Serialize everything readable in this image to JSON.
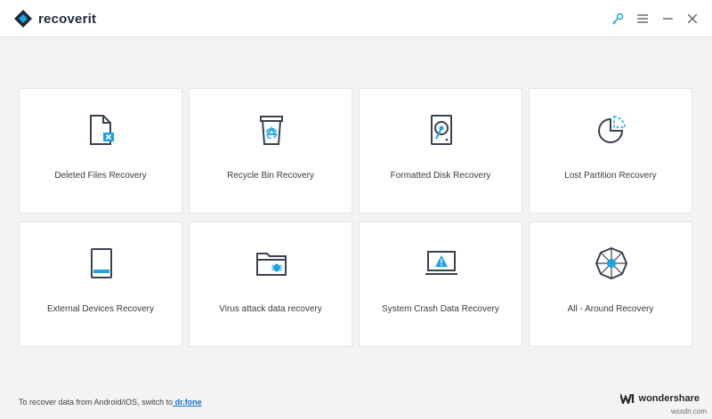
{
  "app": {
    "name": "recoverit"
  },
  "toolbar": {
    "key_icon": "key-icon",
    "menu_icon": "menu-icon",
    "minimize_icon": "minimize-icon",
    "close_icon": "close-icon"
  },
  "cards": [
    {
      "label": "Deleted Files Recovery",
      "icon": "deleted-file-icon"
    },
    {
      "label": "Recycle Bin Recovery",
      "icon": "recycle-bin-icon"
    },
    {
      "label": "Formatted Disk Recovery",
      "icon": "formatted-disk-icon"
    },
    {
      "label": "Lost Partition Recovery",
      "icon": "lost-partition-icon"
    },
    {
      "label": "External Devices Recovery",
      "icon": "external-device-icon"
    },
    {
      "label": "Virus attack data recovery",
      "icon": "virus-folder-icon"
    },
    {
      "label": "System Crash Data Recovery",
      "icon": "system-crash-icon"
    },
    {
      "label": "All - Around Recovery",
      "icon": "all-around-icon"
    }
  ],
  "footer": {
    "text": "To recover data from Android/iOS, switch to",
    "link": " dr.fone"
  },
  "brand": {
    "name": "wondershare"
  },
  "watermark": "wsxdn.com",
  "colors": {
    "accent": "#1ea4e0",
    "icon_stroke": "#3a4150",
    "link": "#1a73c8"
  }
}
